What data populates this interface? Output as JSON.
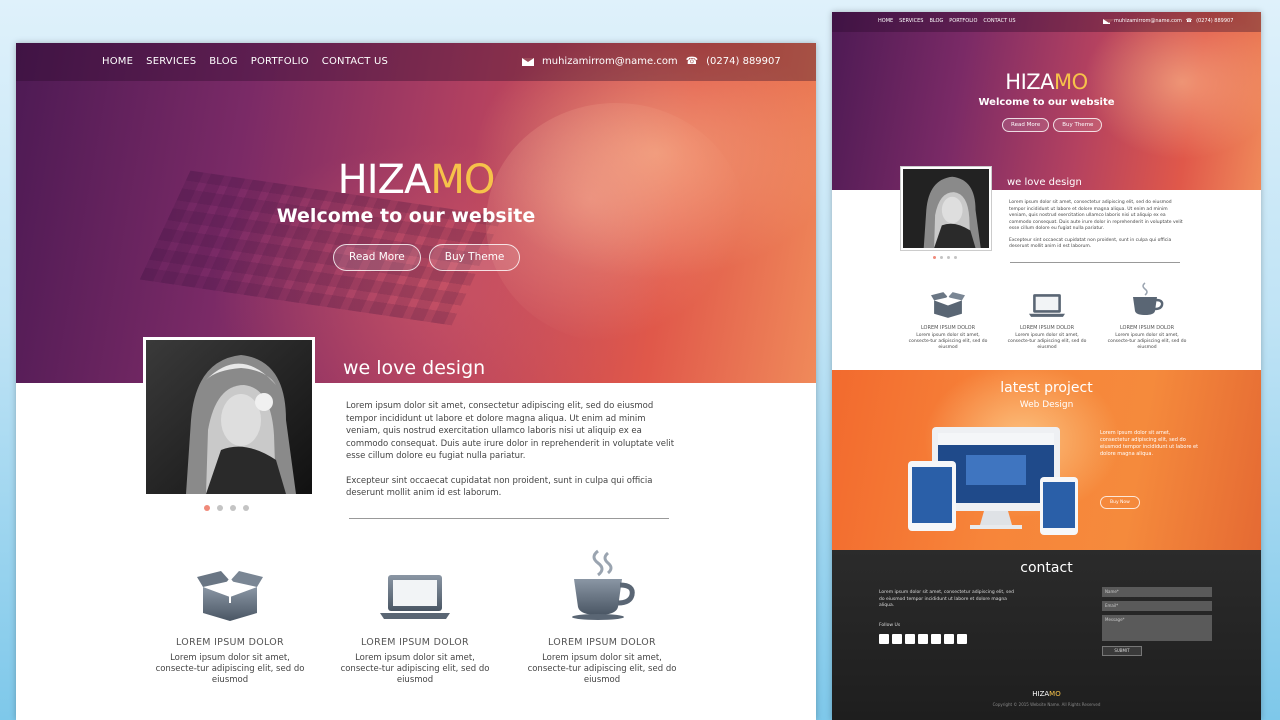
{
  "nav": {
    "items": [
      "HOME",
      "SERVICES",
      "BLOG",
      "PORTFOLIO",
      "CONTACT US"
    ],
    "email": "muhizamirrom@name.com",
    "phone": "(0274) 889907"
  },
  "hero": {
    "brand_part1": "HIZA",
    "brand_part2": "MO",
    "tagline": "Welcome to our website",
    "btn_read": "Read More",
    "btn_buy": "Buy Theme"
  },
  "about": {
    "title": "we love design",
    "para1": "Lorem ipsum dolor sit amet, consectetur adipiscing elit, sed do eiusmod tempor incididunt ut labore et dolore magna aliqua. Ut enim ad minim veniam, quis nostrud exercitation ullamco laboris nisi ut aliquip ex ea commodo consequat. Duis aute irure dolor in reprehenderit in voluptate velit esse cillum dolore eu fugiat nulla pariatur.",
    "para2": "Excepteur sint occaecat cupidatat non proident, sunt in culpa qui officia deserunt mollit anim id est laborum."
  },
  "features": [
    {
      "icon": "box-icon",
      "title": "LOREM IPSUM DOLOR",
      "desc": "Lorem ipsum dolor sit amet, consecte-tur adipiscing elit, sed do eiusmod"
    },
    {
      "icon": "laptop-icon",
      "title": "LOREM IPSUM DOLOR",
      "desc": "Lorem ipsum dolor sit amet, consecte-tur adipiscing elit, sed do eiusmod"
    },
    {
      "icon": "coffee-icon",
      "title": "LOREM IPSUM DOLOR",
      "desc": "Lorem ipsum dolor sit amet, consecte-tur adipiscing elit, sed do eiusmod"
    }
  ],
  "project": {
    "title": "latest project",
    "subtitle": "Web Design",
    "para": "Lorem ipsum dolor sit amet, consectetur adipiscing elit, sed do eiusmod tempor incididunt ut labore et dolore magna aliqua.",
    "btn": "Buy Now"
  },
  "contact": {
    "title": "contact",
    "para": "Lorem ipsum dolor sit amet, consectetur adipiscing elit, sed do eiusmod tempor incididunt ut labore et dolore magna aliqua.",
    "follow": "Follow Us",
    "name_ph": "Name*",
    "email_ph": "Email*",
    "msg_ph": "Message*",
    "submit": "SUBMIT",
    "copyright": "Copyright © 2015 Website Name. All Rights Reserved"
  },
  "colors": {
    "accent": "#f6c24a",
    "hero_start": "#4d1a54",
    "hero_end": "#e0584a",
    "project_orange": "#f7853a"
  }
}
